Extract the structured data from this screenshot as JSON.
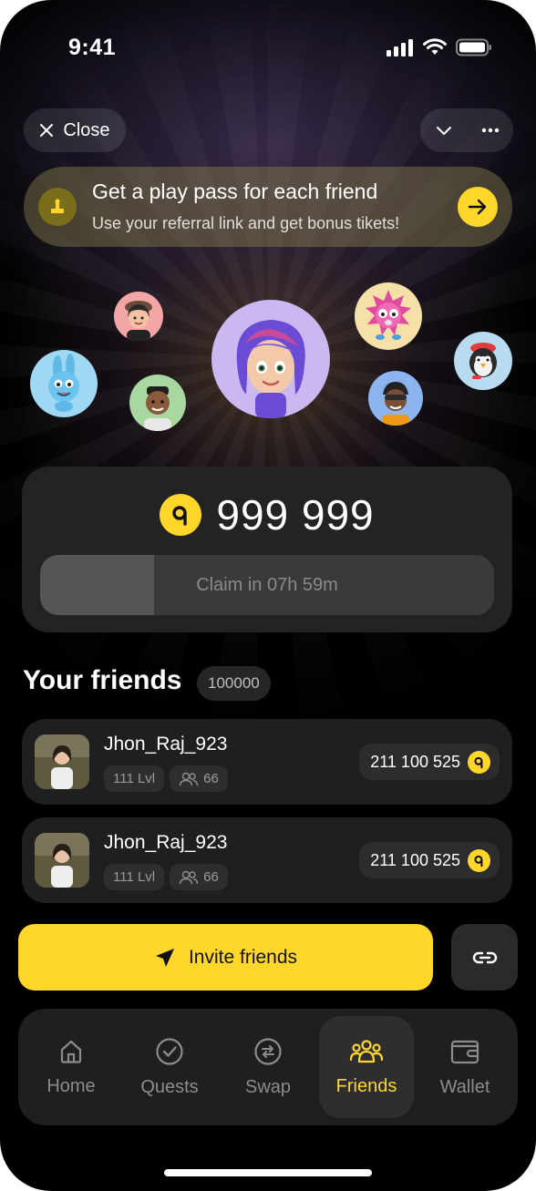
{
  "status_bar": {
    "time": "9:41"
  },
  "header": {
    "close_label": "Close",
    "icons": [
      "close-icon",
      "chevron-down-icon",
      "more-icon"
    ]
  },
  "banner": {
    "title": "Get a play pass for each friend",
    "subtitle": "Use your referral link and get bonus tikets!",
    "icon": "ticket-icon",
    "action_icon": "arrow-right-icon"
  },
  "balance": {
    "value": "999 999",
    "coin_icon": "coin-icon",
    "claim_label": "Claim in 07h 59m",
    "claim_progress": 0.25
  },
  "friends": {
    "title": "Your friends",
    "count": "100000",
    "items": [
      {
        "name": "Jhon_Raj_923",
        "level": "111 Lvl",
        "referrals": "66",
        "score": "211 100 525"
      },
      {
        "name": "Jhon_Raj_923",
        "level": "111 Lvl",
        "referrals": "66",
        "score": "211 100 525"
      }
    ]
  },
  "invite": {
    "label": "Invite friends",
    "icon": "send-icon",
    "link_icon": "link-icon"
  },
  "tabbar": {
    "active": "Friends",
    "tabs": [
      {
        "label": "Home",
        "icon": "home-icon"
      },
      {
        "label": "Quests",
        "icon": "check-circle-icon"
      },
      {
        "label": "Swap",
        "icon": "swap-icon"
      },
      {
        "label": "Friends",
        "icon": "friends-icon"
      },
      {
        "label": "Wallet",
        "icon": "wallet-icon"
      }
    ]
  },
  "colors": {
    "accent": "#ffd72a",
    "background": "#000000",
    "card": "#232323",
    "muted_text": "#8c8c8c"
  }
}
